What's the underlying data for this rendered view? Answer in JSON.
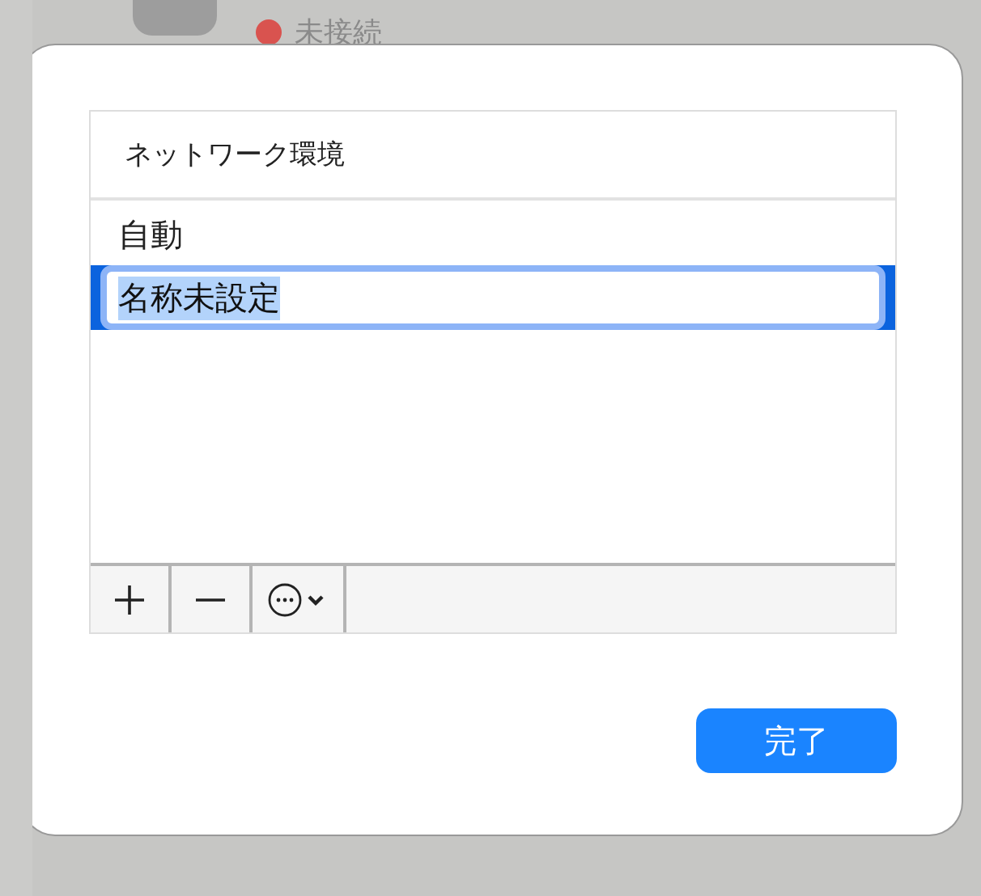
{
  "background": {
    "status": {
      "label": "未接続",
      "color": "#d9534f"
    }
  },
  "dialog": {
    "table": {
      "header": "ネットワーク環境",
      "rows": [
        {
          "name": "自動",
          "selected": false,
          "editing": false
        },
        {
          "name": "名称未設定",
          "selected": true,
          "editing": true
        }
      ]
    },
    "done_button": "完了"
  }
}
